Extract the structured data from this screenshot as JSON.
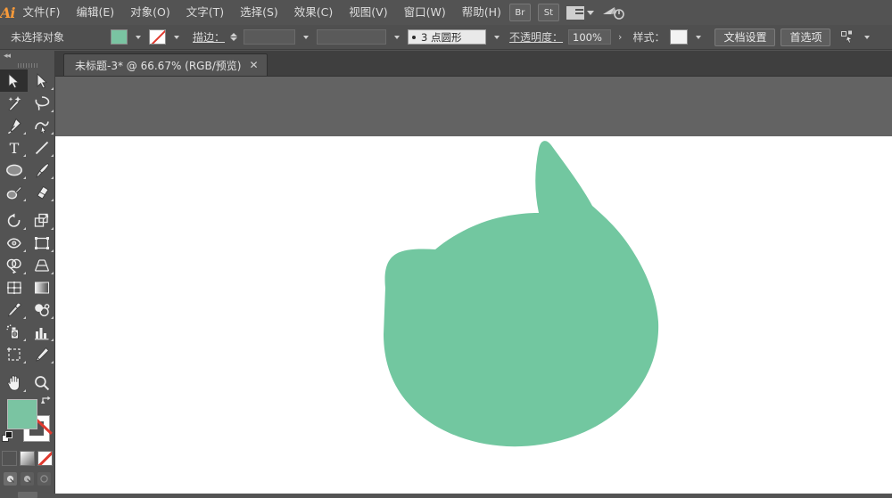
{
  "app": {
    "name": "Ai",
    "logo_text": "Ai"
  },
  "menubar": {
    "items": [
      {
        "label": "文件(F)",
        "name": "menu-file"
      },
      {
        "label": "编辑(E)",
        "name": "menu-edit"
      },
      {
        "label": "对象(O)",
        "name": "menu-object"
      },
      {
        "label": "文字(T)",
        "name": "menu-type"
      },
      {
        "label": "选择(S)",
        "name": "menu-select"
      },
      {
        "label": "效果(C)",
        "name": "menu-effect"
      },
      {
        "label": "视图(V)",
        "name": "menu-view"
      },
      {
        "label": "窗口(W)",
        "name": "menu-window"
      },
      {
        "label": "帮助(H)",
        "name": "menu-help"
      }
    ],
    "bridge_button": "Br",
    "stock_button": "St",
    "arrange_icon": "arrange-documents-icon",
    "search_icon": "search-adobe-stock-icon"
  },
  "controlbar": {
    "selection_status": "未选择对象",
    "fill_swatch_label": "fill-color",
    "stroke_swatch_label": "stroke-none",
    "stroke_label": "描边：",
    "stroke_weight_value": "",
    "stroke_profile_value": "",
    "brush_value": "3 点圆形",
    "opacity_label": "不透明度：",
    "opacity_value": "100%",
    "more_options": "›",
    "style_label": "样式：",
    "style_swatch": "graphic-style-none",
    "document_setup_button": "文档设置",
    "preferences_button": "首选项",
    "align_icon": "align-selection-icon"
  },
  "tabbar": {
    "tab_title": "未标题-3* @ 66.67% (RGB/预览)",
    "close_label": "✕"
  },
  "toolbar": {
    "collapse_label": "◂◂",
    "tools": [
      {
        "name": "selection-tool",
        "active": true
      },
      {
        "name": "direct-selection-tool",
        "active": false
      },
      {
        "name": "magic-wand-tool",
        "active": false
      },
      {
        "name": "lasso-tool",
        "active": false
      },
      {
        "name": "pen-tool",
        "active": false
      },
      {
        "name": "curvature-tool",
        "active": false
      },
      {
        "name": "type-tool",
        "active": false
      },
      {
        "name": "line-segment-tool",
        "active": false
      },
      {
        "name": "ellipse-tool",
        "active": false
      },
      {
        "name": "paintbrush-tool",
        "active": false
      },
      {
        "name": "shaper-tool",
        "active": false
      },
      {
        "name": "eraser-tool",
        "active": false
      },
      {
        "name": "rotate-tool",
        "active": false
      },
      {
        "name": "scale-tool",
        "active": false
      },
      {
        "name": "width-tool",
        "active": false
      },
      {
        "name": "free-transform-tool",
        "active": false
      },
      {
        "name": "shape-builder-tool",
        "active": false
      },
      {
        "name": "perspective-grid-tool",
        "active": false
      },
      {
        "name": "mesh-tool",
        "active": false
      },
      {
        "name": "gradient-tool",
        "active": false
      },
      {
        "name": "eyedropper-tool",
        "active": false
      },
      {
        "name": "blend-tool",
        "active": false
      },
      {
        "name": "symbol-sprayer-tool",
        "active": false
      },
      {
        "name": "column-graph-tool",
        "active": false
      },
      {
        "name": "artboard-tool",
        "active": false
      },
      {
        "name": "slice-tool",
        "active": false
      },
      {
        "name": "hand-tool",
        "active": false
      },
      {
        "name": "zoom-tool",
        "active": false
      }
    ],
    "fill_color": "#7ac4a2",
    "stroke_color": "none",
    "color_mode_buttons": [
      "color-button",
      "gradient-button",
      "none-button"
    ],
    "draw_modes": [
      "draw-normal",
      "draw-behind",
      "draw-inside"
    ],
    "screen_mode": "change-screen-mode"
  },
  "artwork": {
    "shape_name": "cat-head-blob-shape",
    "fill": "#72c7a0",
    "stroke": "none"
  }
}
